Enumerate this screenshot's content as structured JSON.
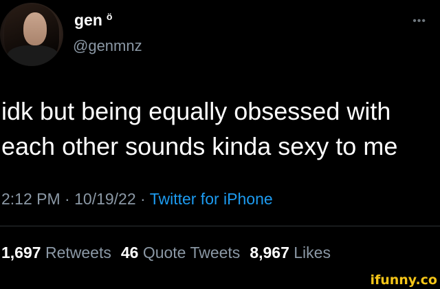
{
  "author": {
    "name": "gen",
    "name_emoji": "ö",
    "handle": "@genmnz",
    "avatar": "profile-photo"
  },
  "menu": {
    "more_label": "•••"
  },
  "tweet": {
    "text_line1": "idk but being equally obsessed with",
    "text_line2": "each other sounds kinda sexy to me",
    "time": "2:12 PM",
    "date": "10/19/22",
    "separator": "·",
    "source": "Twitter for iPhone"
  },
  "stats": {
    "retweets_count": "1,697",
    "retweets_label": "Retweets",
    "quote_count": "46",
    "quote_label": "Quote Tweets",
    "likes_count": "8,967",
    "likes_label": "Likes"
  },
  "watermark": {
    "text": "ifunny.co"
  },
  "colors": {
    "background": "#000000",
    "primary_text": "#ffffff",
    "secondary_text": "#8b98a5",
    "link": "#1d9bf0",
    "divider": "#2f3336",
    "watermark": "#f5c518"
  }
}
